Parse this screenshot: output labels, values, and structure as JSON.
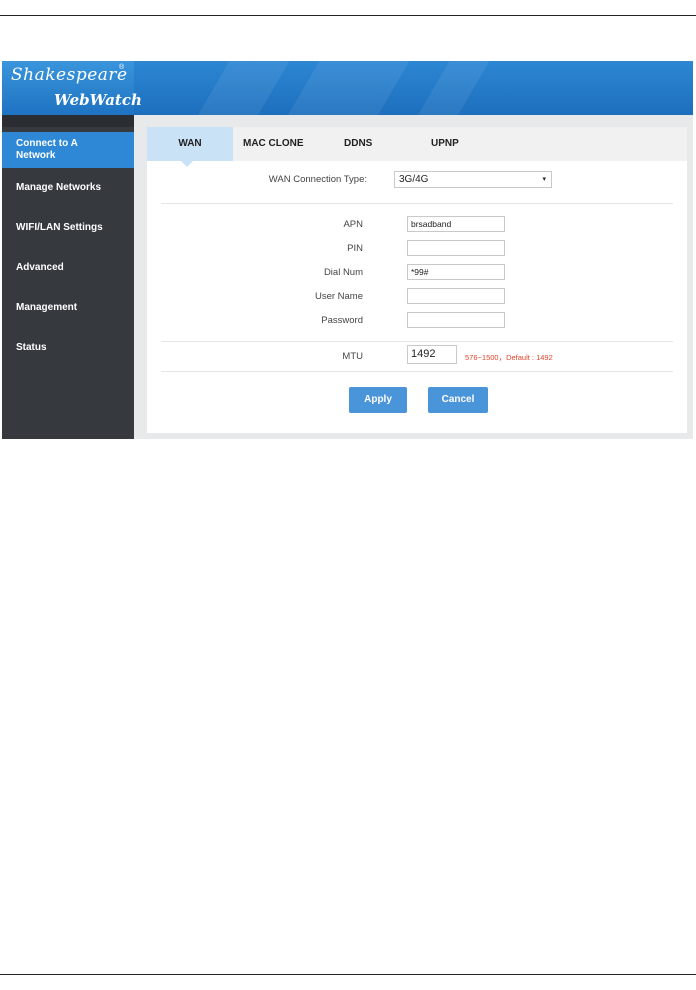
{
  "brand": {
    "name": "Shakespeare",
    "trademark": "®",
    "product": "WebWatch"
  },
  "sidebar": {
    "items": [
      {
        "label": "Connect to A Network",
        "active": true
      },
      {
        "label": "Manage Networks"
      },
      {
        "label": "WIFI/LAN Settings"
      },
      {
        "label": "Advanced"
      },
      {
        "label": "Management"
      },
      {
        "label": "Status"
      }
    ]
  },
  "tabs": [
    {
      "label": "WAN",
      "active": true
    },
    {
      "label": "MAC CLONE"
    },
    {
      "label": "DDNS"
    },
    {
      "label": "UPNP"
    }
  ],
  "form": {
    "connection_type": {
      "label": "WAN Connection Type:",
      "value": "3G/4G",
      "arrow": "▾"
    },
    "apn": {
      "label": "APN",
      "value": "brsadband"
    },
    "pin": {
      "label": "PIN",
      "value": ""
    },
    "dial_num": {
      "label": "Dial Num",
      "value": "*99#"
    },
    "user_name": {
      "label": "User Name",
      "value": ""
    },
    "password": {
      "label": "Password",
      "value": ""
    },
    "mtu": {
      "label": "MTU",
      "value": "1492",
      "hint": "576~1500，Default : 1492"
    }
  },
  "buttons": {
    "apply": "Apply",
    "cancel": "Cancel"
  },
  "colors": {
    "header_blue": "#2d87d3",
    "sidebar_bg": "#363a3f",
    "active_nav": "#2f88d6",
    "active_tab": "#c9e2f6",
    "button": "#4a94da",
    "hint_red": "#e0452b"
  }
}
